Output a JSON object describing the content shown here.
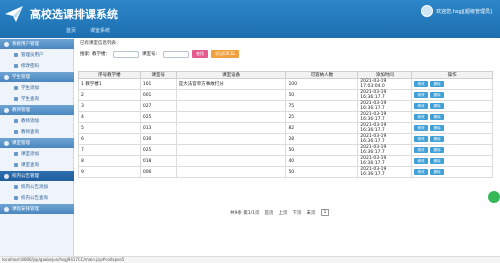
{
  "app": {
    "title": "高校选课排课系统"
  },
  "header": {
    "user_text": "欢迎您,hsgj[超级管理员]",
    "tabs": [
      "首页",
      "课室系统"
    ]
  },
  "sidebar": {
    "groups": [
      {
        "label": "系统用户管理",
        "items": [
          "管理员用户",
          "修改密码"
        ]
      },
      {
        "label": "学生管理",
        "items": [
          "学生添加",
          "学生查询"
        ]
      },
      {
        "label": "教师管理",
        "items": [
          "教师添加",
          "教师查询"
        ]
      },
      {
        "label": "课室管理",
        "items": [
          "课室添加",
          "课室查询"
        ]
      },
      {
        "label": "校内公告管理",
        "items": [
          "校内公告添加",
          "校内公告查询"
        ]
      },
      {
        "label": "课程安排管理",
        "items": []
      }
    ]
  },
  "main": {
    "breadcrumb": "已有课室信息列表：",
    "search": {
      "label_building": "搜索: 教学楼：",
      "label_code": "课室号：",
      "btn_search": "查找",
      "btn_excel": "导出EXCEL"
    },
    "table": {
      "headers": [
        "序号",
        "教学楼",
        "课室号",
        "课室设备",
        "可容纳人数",
        "添加时间",
        "操作"
      ],
      "rows": [
        {
          "idx": "1",
          "building": "教学楼1",
          "code": "101",
          "equipment": "是大法官单方事故打分",
          "capacity": "100",
          "time": [
            "2021-03-19",
            "17:03:04.0"
          ]
        },
        {
          "idx": "2",
          "building": "",
          "code": "001",
          "equipment": "",
          "capacity": "50",
          "time": [
            "2021-03-19",
            "16:36:17.7"
          ]
        },
        {
          "idx": "3",
          "building": "",
          "code": "027",
          "equipment": "",
          "capacity": "75",
          "time": [
            "2021-03-19",
            "16:36:17.7"
          ]
        },
        {
          "idx": "4",
          "building": "",
          "code": "025",
          "equipment": "",
          "capacity": "25",
          "time": [
            "2021-03-19",
            "16:36:17.7"
          ]
        },
        {
          "idx": "5",
          "building": "",
          "code": "013",
          "equipment": "",
          "capacity": "82",
          "time": [
            "2021-03-19",
            "16:36:17.7"
          ]
        },
        {
          "idx": "6",
          "building": "",
          "code": "030",
          "equipment": "",
          "capacity": "28",
          "time": [
            "2021-03-19",
            "16:36:17.7"
          ]
        },
        {
          "idx": "7",
          "building": "",
          "code": "025",
          "equipment": "",
          "capacity": "50",
          "time": [
            "2021-03-19",
            "16:36:17.7"
          ]
        },
        {
          "idx": "8",
          "building": "",
          "code": "018",
          "equipment": "",
          "capacity": "40",
          "time": [
            "2021-03-19",
            "16:36:17.7"
          ]
        },
        {
          "idx": "9",
          "building": "",
          "code": "006",
          "equipment": "",
          "capacity": "50",
          "time": [
            "2021-03-19",
            "16:36:17.7"
          ]
        }
      ],
      "op_edit": "修改",
      "op_delete": "删除"
    },
    "pager": {
      "summary": "共9条  第1/1页",
      "first": "首页",
      "prev": "上页",
      "next": "下页",
      "last": "末页",
      "page": "1"
    }
  },
  "statusbar": {
    "url": "localhost:8080/jsp/gaokejun/hsgj9417CC/main.jsp#collapse5"
  }
}
